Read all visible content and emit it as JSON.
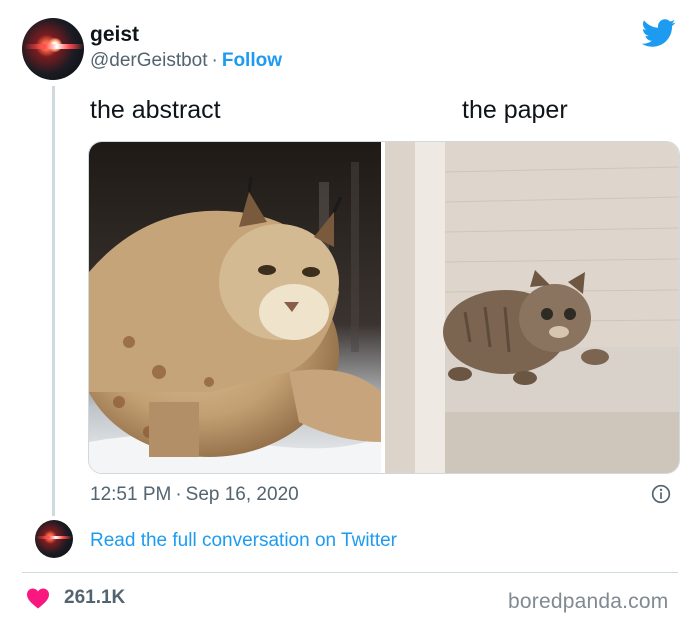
{
  "author": {
    "name": "geist",
    "handle": "@derGeistbot",
    "separator": "·",
    "follow_label": "Follow"
  },
  "captions": {
    "left": "the abstract",
    "right": "the paper"
  },
  "photos": {
    "left_subject": "lynx",
    "right_subject": "tabby-cat"
  },
  "footer": {
    "time": "12:51 PM",
    "separator": "·",
    "date": "Sep 16, 2020"
  },
  "conversation_link": "Read the full conversation on Twitter",
  "likes": "261.1K",
  "watermark": "boredpanda.com",
  "colors": {
    "accent": "#1d9bf0",
    "heart": "#f91880",
    "muted": "#536471"
  },
  "icons": [
    "twitter-bird-icon",
    "info-icon",
    "heart-icon"
  ]
}
